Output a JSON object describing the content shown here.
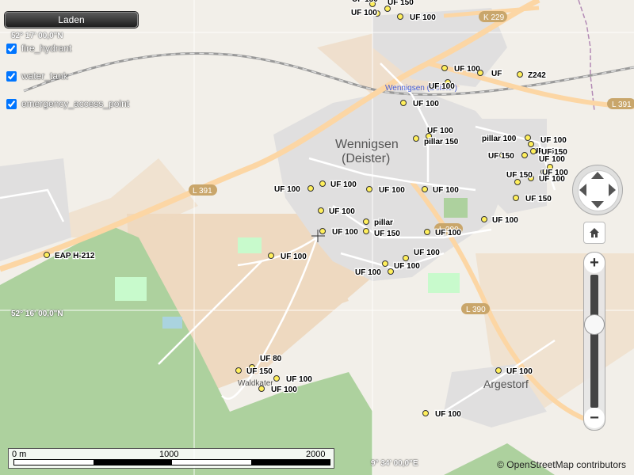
{
  "load_button": "Laden",
  "layers": [
    {
      "label": "fire_hydrant",
      "checked": true
    },
    {
      "label": "water_tank",
      "checked": true
    },
    {
      "label": "emergency_access_point",
      "checked": true
    }
  ],
  "graticule": {
    "lat_top": "52° 17' 00,0\"N",
    "lat_mid": "52° 16' 00,0\"N",
    "lon": "9° 34' 00,0\"E"
  },
  "place_labels": {
    "town": "Wennigsen",
    "town_sub": "(Deister)",
    "station": "Wennigsen (Deister)",
    "village": "Argestorf",
    "hamlet": "Waldkater"
  },
  "road_labels": {
    "k229": "K 229",
    "l391a": "L 391",
    "l391b": "L 391",
    "l390a": "L 390",
    "l390b": "L 390"
  },
  "markers": [
    {
      "label": "UF 150"
    },
    {
      "label": "UF 100"
    },
    {
      "label": "UF 150"
    },
    {
      "label": "UF 100"
    },
    {
      "label": "UF 100"
    },
    {
      "label": "UF"
    },
    {
      "label": "UF 100"
    },
    {
      "label": "Z242"
    },
    {
      "label": "UF 100"
    },
    {
      "label": "UF 100"
    },
    {
      "label": "pillar 150"
    },
    {
      "label": "pillar 100"
    },
    {
      "label": "UF 100"
    },
    {
      "label": "UF 150"
    },
    {
      "label": "UF 150"
    },
    {
      "label": "UF 100"
    },
    {
      "label": "UF 150"
    },
    {
      "label": "UF 100"
    },
    {
      "label": "UF 100"
    },
    {
      "label": "UF 150"
    },
    {
      "label": "UF 150"
    },
    {
      "label": "UF 100"
    },
    {
      "label": "UF 100"
    },
    {
      "label": "UF 100"
    },
    {
      "label": "UF 100"
    },
    {
      "label": "pillar"
    },
    {
      "label": "UF 150"
    },
    {
      "label": "UF 100"
    },
    {
      "label": "UF 100"
    },
    {
      "label": "UF 100"
    },
    {
      "label": "UF 100"
    },
    {
      "label": "UF 100"
    },
    {
      "label": "UF 100"
    },
    {
      "label": "EAP H-212"
    },
    {
      "label": "UF 80"
    },
    {
      "label": "UF 150"
    },
    {
      "label": "UF 100"
    },
    {
      "label": "UF 100"
    },
    {
      "label": "UF 100"
    },
    {
      "label": "UF 100"
    },
    {
      "label": "UF 100"
    },
    {
      "label": "UF 100"
    }
  ],
  "scale": {
    "start": "0 m",
    "mid": "1000",
    "end": "2000"
  },
  "attribution": "© OpenStreetMap contributors",
  "controls": {
    "zoom_in": "+",
    "zoom_out": "−",
    "zoom_level": 0.63
  }
}
